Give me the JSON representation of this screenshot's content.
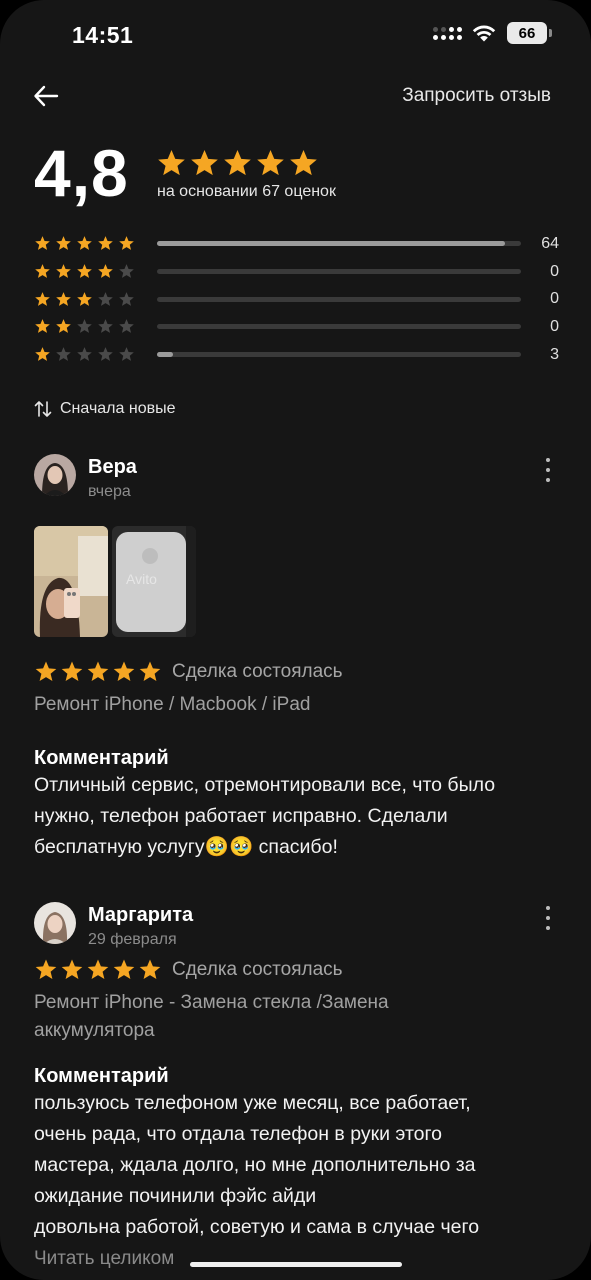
{
  "status_bar": {
    "time": "14:51",
    "battery": "66"
  },
  "nav": {
    "request_review": "Запросить отзыв"
  },
  "summary": {
    "rating": "4,8",
    "based_on": "на основании 67 оценок",
    "distribution": [
      {
        "stars": 5,
        "count": "64",
        "fraction": 0.955
      },
      {
        "stars": 4,
        "count": "0",
        "fraction": 0
      },
      {
        "stars": 3,
        "count": "0",
        "fraction": 0
      },
      {
        "stars": 2,
        "count": "0",
        "fraction": 0
      },
      {
        "stars": 1,
        "count": "3",
        "fraction": 0.045
      }
    ]
  },
  "sort": {
    "label": "Сначала новые"
  },
  "reviews": [
    {
      "name": "Вера",
      "date": "вчера",
      "deal": "Сделка состоялась",
      "category": "Ремонт iPhone / Macbook / iPad",
      "comment_title": "Комментарий",
      "comment": [
        "Отличный сервис, отремонтировали все, что было",
        "нужно, телефон работает исправно. Сделали",
        "бесплатную услугу🥹🥹 спасибо!"
      ]
    },
    {
      "name": "Маргарита",
      "date": "29 февраля",
      "deal": "Сделка состоялась",
      "category": [
        "Ремонт iPhone - Замена стекла /Замена",
        "аккумулятора"
      ],
      "comment_title": "Комментарий",
      "comment": [
        "пользуюсь телефоном уже месяц, все работает,",
        "очень рада, что отдала телефон в руки этого",
        "мастера, ждала долго, но мне дополнительно за",
        "ожидание починили фэйс айди",
        "довольна работой, советую и сама в случае чего"
      ],
      "read_more": "Читать целиком"
    }
  ],
  "colors": {
    "background": "#161616",
    "star": "#f5a623",
    "star_empty": "#4a4a4a",
    "bar_fill": "#9b9b9b",
    "bar_track": "#3a3a3a",
    "muted": "#8c8c8c"
  }
}
